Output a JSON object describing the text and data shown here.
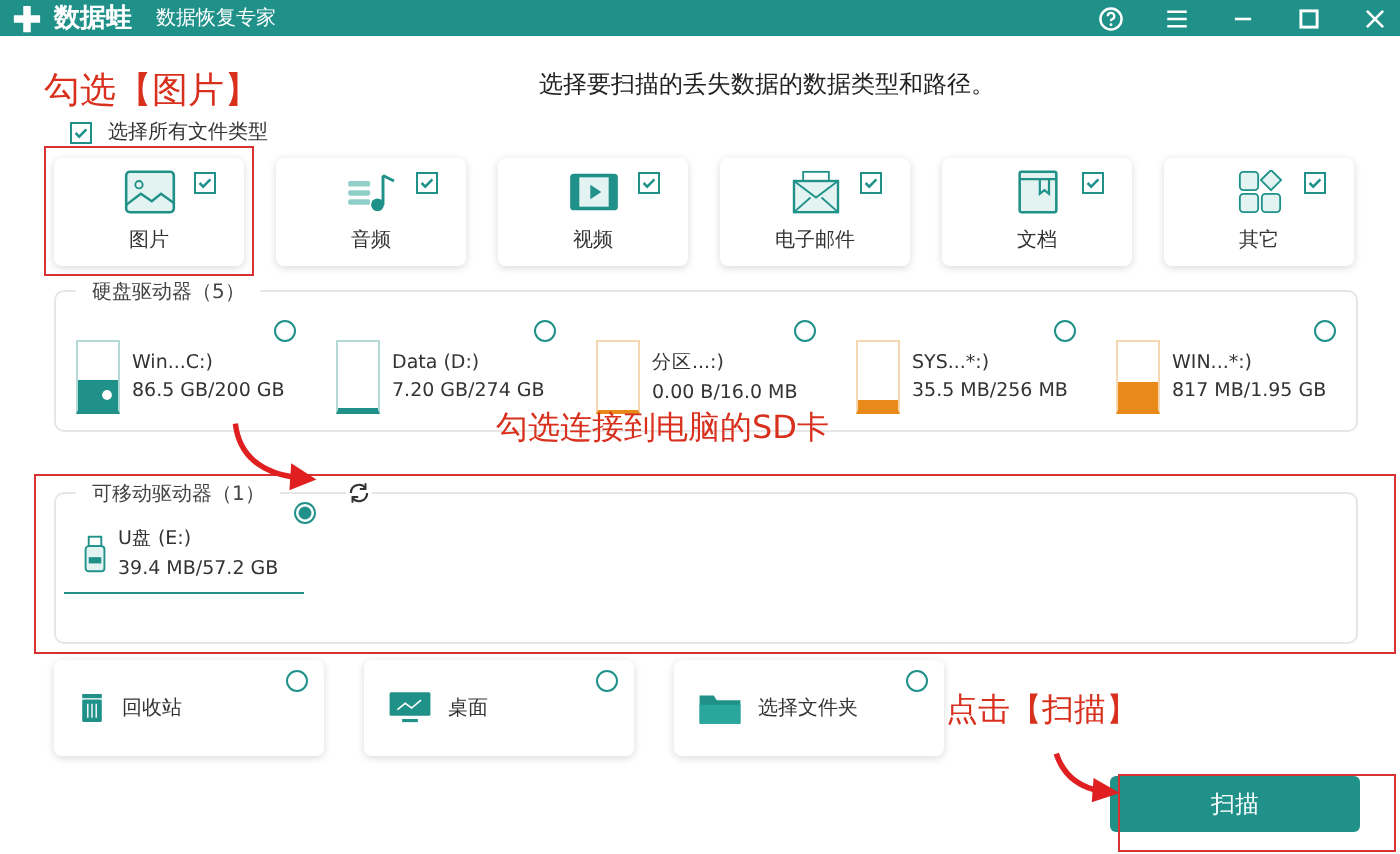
{
  "app": {
    "name": "数据蛙",
    "subtitle": "数据恢复专家"
  },
  "heading": "选择要扫描的丢失数据的数据类型和路径。",
  "select_all": {
    "label": "选择所有文件类型",
    "checked": true
  },
  "file_types": [
    {
      "kind": "image",
      "label": "图片",
      "checked": true
    },
    {
      "kind": "audio",
      "label": "音频",
      "checked": true
    },
    {
      "kind": "video",
      "label": "视频",
      "checked": true
    },
    {
      "kind": "email",
      "label": "电子邮件",
      "checked": true
    },
    {
      "kind": "document",
      "label": "文档",
      "checked": true
    },
    {
      "kind": "other",
      "label": "其它",
      "checked": true
    }
  ],
  "hard_drives": {
    "title": "硬盘驱动器（5）",
    "items": [
      {
        "name": "Win...C:)",
        "usage": "86.5 GB/200 GB",
        "level": 0.43,
        "color": "#1f9189",
        "selected": false,
        "system": true
      },
      {
        "name": "Data (D:)",
        "usage": "7.20 GB/274 GB",
        "level": 0.03,
        "color": "#1f9189",
        "selected": false,
        "system": false
      },
      {
        "name": "分区...:)",
        "usage": "0.00  B/16.0 MB",
        "level": 0,
        "color": "#e8891a",
        "selected": false,
        "system": false
      },
      {
        "name": "SYS...*:)",
        "usage": "35.5 MB/256 MB",
        "level": 0.14,
        "color": "#e8891a",
        "selected": false,
        "system": false
      },
      {
        "name": "WIN...*:)",
        "usage": "817 MB/1.95 GB",
        "level": 0.42,
        "color": "#e8891a",
        "selected": false,
        "system": false
      }
    ]
  },
  "removable_drives": {
    "title": "可移动驱动器（1）",
    "items": [
      {
        "name": "U盘 (E:)",
        "usage": "39.4 MB/57.2 GB",
        "selected": true
      }
    ]
  },
  "locations": [
    {
      "kind": "recycle",
      "label": "回收站",
      "selected": false
    },
    {
      "kind": "desktop",
      "label": "桌面",
      "selected": false
    },
    {
      "kind": "folder",
      "label": "选择文件夹",
      "selected": false
    }
  ],
  "scan_button": "扫描",
  "annotations": [
    "勾选【图片】",
    "勾选连接到电脑的SD卡",
    "点击【扫描】"
  ]
}
